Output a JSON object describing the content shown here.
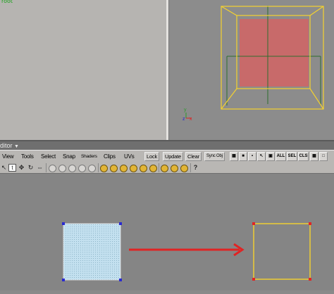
{
  "explorer": {
    "label": "root"
  },
  "editor": {
    "title": "ditor"
  },
  "menu": {
    "items": [
      "View",
      "Tools",
      "Select",
      "Snap",
      "Shaders",
      "Clips",
      "UVs"
    ],
    "buttons": [
      "Lock",
      "Update",
      "Clear",
      "Sync Obj"
    ],
    "icon_buttons": [
      "ALL",
      "SEL",
      "CLS"
    ]
  },
  "toolbar": {
    "icons": [
      "pointer-icon",
      "move-icon",
      "rotate-icon",
      "scale-icon",
      "snap-icon",
      "question-icon"
    ],
    "help": "?"
  },
  "viewport": {
    "axes": [
      "y",
      "z",
      "x"
    ]
  },
  "colors": {
    "wire_yellow": "#f5d22e",
    "wire_green": "#2e6e2e",
    "face_red": "#c86a6a",
    "arrow_red": "#e02424",
    "uv_fill": "#b9d9ea"
  }
}
